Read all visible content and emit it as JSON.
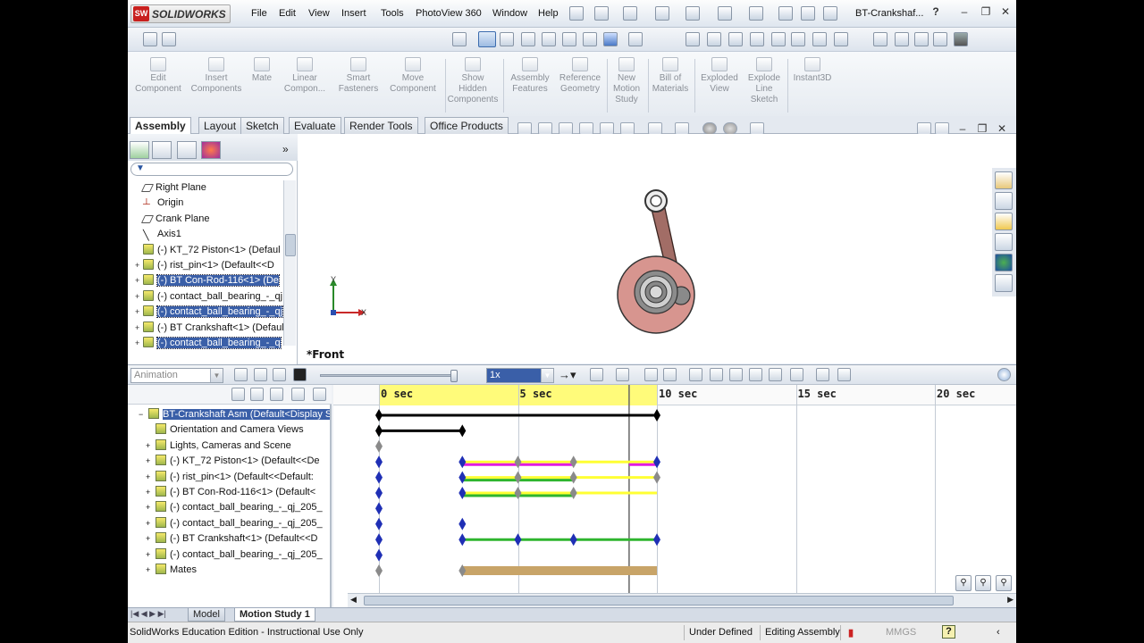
{
  "app": {
    "brand": "SOLIDWORKS",
    "menu": [
      "File",
      "Edit",
      "View",
      "Insert",
      "Tools",
      "PhotoView 360",
      "Window",
      "Help"
    ],
    "document_title": "BT-Crankshaf...",
    "help_glyph": "?"
  },
  "ribbon": {
    "buttons": [
      {
        "label": "Edit\nComponent",
        "icon": "edit-component-icon"
      },
      {
        "label": "Insert\nComponents",
        "icon": "insert-components-icon"
      },
      {
        "label": "Mate",
        "icon": "mate-icon"
      },
      {
        "label": "Linear\nCompon...",
        "icon": "linear-pattern-icon"
      },
      {
        "label": "Smart\nFasteners",
        "icon": "smart-fasteners-icon"
      },
      {
        "label": "Move\nComponent",
        "icon": "move-component-icon"
      },
      {
        "label": "Show\nHidden\nComponents",
        "icon": "show-hidden-icon"
      },
      {
        "label": "Assembly\nFeatures",
        "icon": "assembly-features-icon"
      },
      {
        "label": "Reference\nGeometry",
        "icon": "reference-geometry-icon"
      },
      {
        "label": "New\nMotion\nStudy",
        "icon": "new-motion-study-icon"
      },
      {
        "label": "Bill of\nMaterials",
        "icon": "bill-of-materials-icon"
      },
      {
        "label": "Exploded\nView",
        "icon": "exploded-view-icon"
      },
      {
        "label": "Explode\nLine\nSketch",
        "icon": "explode-line-sketch-icon"
      },
      {
        "label": "Instant3D",
        "icon": "instant3d-icon"
      }
    ]
  },
  "command_tabs": [
    "Assembly",
    "Layout",
    "Sketch",
    "Evaluate",
    "Render Tools",
    "Office Products"
  ],
  "active_command_tab": "Assembly",
  "feature_tree": {
    "items": [
      {
        "label": "Right Plane",
        "icon": "plane-icon",
        "expand": ""
      },
      {
        "label": "Origin",
        "icon": "origin-icon",
        "expand": ""
      },
      {
        "label": "Crank Plane",
        "icon": "plane-icon",
        "expand": ""
      },
      {
        "label": "Axis1",
        "icon": "axis-icon",
        "expand": ""
      },
      {
        "label": "(-) KT_72 Piston<1> (Defaul",
        "icon": "part-icon",
        "expand": ""
      },
      {
        "label": "(-) rist_pin<1> (Default<<D",
        "icon": "part-icon",
        "expand": "+"
      },
      {
        "label": "(-) BT Con-Rod-116<1> (De",
        "icon": "part-icon",
        "expand": "+",
        "selected": true
      },
      {
        "label": "(-) contact_ball_bearing_-_qj",
        "icon": "part-icon",
        "expand": "+"
      },
      {
        "label": "(-) contact_ball_bearing_-_qj",
        "icon": "part-icon",
        "expand": "+",
        "selected": true
      },
      {
        "label": "(-) BT Crankshaft<1> (Defaul",
        "icon": "part-icon",
        "expand": "+"
      },
      {
        "label": "(-) contact_ball_bearing_-_q",
        "icon": "part-icon",
        "expand": "+",
        "selected": true
      }
    ]
  },
  "viewport": {
    "view_label": "*Front",
    "triad_x": "X",
    "triad_y": "Y"
  },
  "motion": {
    "study_type": "Animation",
    "playback_speed": "1x",
    "timeline_labels": [
      "0 sec",
      "5 sec",
      "10 sec",
      "15 sec",
      "20 sec"
    ],
    "timeline_seconds": [
      0,
      5,
      10,
      15,
      20
    ],
    "highlight_range_sec": [
      0,
      10
    ],
    "time_bar_sec": 9.0,
    "tree": [
      {
        "label": "BT-Crankshaft Asm  (Default<Display S",
        "expand": "−",
        "selected": true,
        "indent": 0
      },
      {
        "label": "Orientation and Camera Views",
        "expand": "",
        "indent": 1
      },
      {
        "label": "Lights, Cameras and Scene",
        "expand": "+",
        "indent": 1
      },
      {
        "label": "(-) KT_72 Piston<1> (Default<<De",
        "expand": "+",
        "indent": 1
      },
      {
        "label": "(-) rist_pin<1> (Default<<Default:",
        "expand": "+",
        "indent": 1
      },
      {
        "label": "(-) BT Con-Rod-116<1> (Default<",
        "expand": "+",
        "indent": 1
      },
      {
        "label": "(-) contact_ball_bearing_-_qj_205_",
        "expand": "+",
        "indent": 1
      },
      {
        "label": "(-) contact_ball_bearing_-_qj_205_",
        "expand": "+",
        "indent": 1
      },
      {
        "label": "(-) BT Crankshaft<1> (Default<<D",
        "expand": "+",
        "indent": 1
      },
      {
        "label": "(-) contact_ball_bearing_-_qj_205_",
        "expand": "+",
        "indent": 1
      },
      {
        "label": "Mates",
        "expand": "+",
        "indent": 1
      }
    ],
    "tracks": [
      {
        "segments": [
          {
            "from": 0,
            "to": 10,
            "color": "#000000"
          }
        ],
        "keys": [
          {
            "t": 0,
            "c": "#000"
          },
          {
            "t": 10,
            "c": "#000"
          }
        ]
      },
      {
        "segments": [
          {
            "from": 0,
            "to": 3,
            "color": "#000000"
          }
        ],
        "keys": [
          {
            "t": 0,
            "c": "#000"
          },
          {
            "t": 3,
            "c": "#000"
          }
        ]
      },
      {
        "segments": [],
        "keys": [
          {
            "t": 0,
            "c": "#8a8a8a"
          }
        ]
      },
      {
        "segments": [
          {
            "from": 3,
            "to": 10,
            "color": "#ffff33"
          },
          {
            "from": 3,
            "to": 7,
            "color": "#e01be0"
          },
          {
            "from": 9,
            "to": 10,
            "color": "#e01be0"
          }
        ],
        "keys": [
          {
            "t": 0,
            "c": "#1f2fb5"
          },
          {
            "t": 3,
            "c": "#1f2fb5"
          },
          {
            "t": 5,
            "c": "#8a8a8a"
          },
          {
            "t": 7,
            "c": "#8a8a8a"
          },
          {
            "t": 10,
            "c": "#1f2fb5"
          }
        ]
      },
      {
        "segments": [
          {
            "from": 3,
            "to": 10,
            "color": "#ffff33"
          },
          {
            "from": 3,
            "to": 7,
            "color": "#2fb52f"
          }
        ],
        "keys": [
          {
            "t": 0,
            "c": "#1f2fb5"
          },
          {
            "t": 3,
            "c": "#1f2fb5"
          },
          {
            "t": 5,
            "c": "#8a8a8a"
          },
          {
            "t": 7,
            "c": "#8a8a8a"
          },
          {
            "t": 10,
            "c": "#8a8a8a"
          }
        ]
      },
      {
        "segments": [
          {
            "from": 3,
            "to": 10,
            "color": "#ffff33"
          },
          {
            "from": 3,
            "to": 7,
            "color": "#2fb52f"
          }
        ],
        "keys": [
          {
            "t": 0,
            "c": "#1f2fb5"
          },
          {
            "t": 3,
            "c": "#1f2fb5"
          },
          {
            "t": 5,
            "c": "#8a8a8a"
          },
          {
            "t": 7,
            "c": "#8a8a8a"
          }
        ]
      },
      {
        "segments": [],
        "keys": [
          {
            "t": 0,
            "c": "#1f2fb5"
          }
        ]
      },
      {
        "segments": [],
        "keys": [
          {
            "t": 0,
            "c": "#1f2fb5"
          },
          {
            "t": 3,
            "c": "#1f2fb5"
          }
        ]
      },
      {
        "segments": [
          {
            "from": 3,
            "to": 10,
            "color": "#2fb52f"
          }
        ],
        "keys": [
          {
            "t": 0,
            "c": "#1f2fb5"
          },
          {
            "t": 3,
            "c": "#1f2fb5"
          },
          {
            "t": 5,
            "c": "#1f2fb5"
          },
          {
            "t": 7,
            "c": "#1f2fb5"
          },
          {
            "t": 10,
            "c": "#1f2fb5"
          }
        ]
      },
      {
        "segments": [],
        "keys": [
          {
            "t": 0,
            "c": "#1f2fb5"
          }
        ]
      },
      {
        "segments": [
          {
            "from": 3,
            "to": 10,
            "color": "#c8a468"
          }
        ],
        "keys": [
          {
            "t": 0,
            "c": "#8a8a8a"
          },
          {
            "t": 3,
            "c": "#8a8a8a"
          }
        ]
      }
    ]
  },
  "bottom_tabs": [
    "Model",
    "Motion Study 1"
  ],
  "active_bottom_tab": "Motion Study 1",
  "status": {
    "edition": "SolidWorks Education Edition - Instructional Use Only",
    "definition": "Under Defined",
    "mode": "Editing Assembly",
    "units": "MMGS",
    "help": "?"
  },
  "colors": {
    "accent_selection": "#3a5fa8",
    "timeline_highlight": "#fffb7a",
    "disk": "#d7958f",
    "rod": "#a26d66"
  }
}
